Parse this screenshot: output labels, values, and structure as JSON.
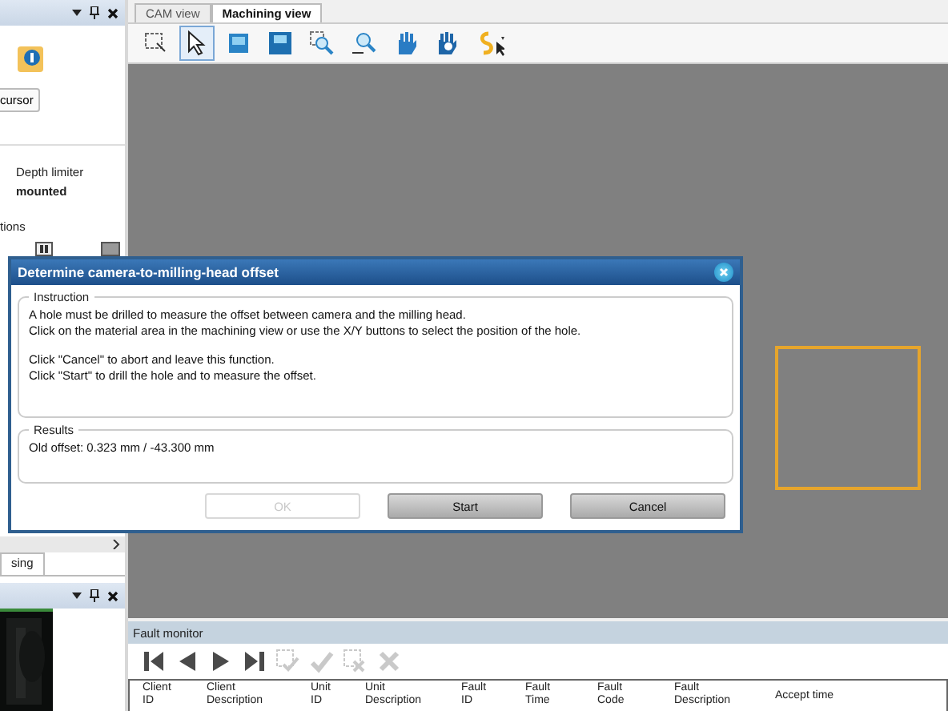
{
  "left_panel": {
    "cursor_button": "cursor",
    "depth_label": "Depth limiter",
    "depth_value": "mounted",
    "group_label": "tions",
    "tab_label": "sing"
  },
  "tabs": [
    {
      "label": "CAM view",
      "selected": false
    },
    {
      "label": "Machining view",
      "selected": true
    }
  ],
  "toolbar": [
    {
      "kind": "lasso",
      "selected": false
    },
    {
      "kind": "pointer",
      "selected": true
    },
    {
      "kind": "fit",
      "selected": false
    },
    {
      "kind": "fit-all",
      "selected": false
    },
    {
      "kind": "zoom-box",
      "selected": false
    },
    {
      "kind": "zoom",
      "selected": false
    },
    {
      "kind": "hand",
      "selected": false
    },
    {
      "kind": "hand-rotate",
      "selected": false
    },
    {
      "kind": "snap",
      "selected": false
    }
  ],
  "dialog": {
    "title": "Determine camera-to-milling-head offset",
    "instruction_label": "Instruction",
    "paragraphs": [
      [
        "A hole must be drilled to measure the offset between camera and the milling head.",
        "Click on the material area in the machining view or use the X/Y buttons to select the position of the hole."
      ],
      [
        "Click \"Cancel\" to abort and leave this function.",
        "Click \"Start\" to drill the hole and to measure the offset."
      ]
    ],
    "results_label": "Results",
    "results_text": "Old offset: 0.323 mm / -43.300 mm",
    "buttons": [
      {
        "label": "OK",
        "disabled": true
      },
      {
        "label": "Start",
        "disabled": false
      },
      {
        "label": "Cancel",
        "disabled": false
      }
    ]
  },
  "fault_monitor": {
    "title": "Fault monitor",
    "tools": [
      {
        "kind": "first",
        "disabled": false
      },
      {
        "kind": "prev",
        "disabled": false
      },
      {
        "kind": "next",
        "disabled": false
      },
      {
        "kind": "last",
        "disabled": false
      },
      {
        "kind": "accept-sel",
        "disabled": true
      },
      {
        "kind": "accept",
        "disabled": true
      },
      {
        "kind": "delete-sel",
        "disabled": true
      },
      {
        "kind": "delete",
        "disabled": true
      }
    ],
    "columns": [
      [
        "Client",
        "ID"
      ],
      [
        "Client",
        "Description"
      ],
      [
        "Unit",
        "ID"
      ],
      [
        "Unit",
        "Description"
      ],
      [
        "Fault",
        "ID"
      ],
      [
        "Fault",
        "Time"
      ],
      [
        "Fault",
        "Code"
      ],
      [
        "Fault",
        "Description"
      ],
      [
        "Accept time"
      ]
    ]
  }
}
